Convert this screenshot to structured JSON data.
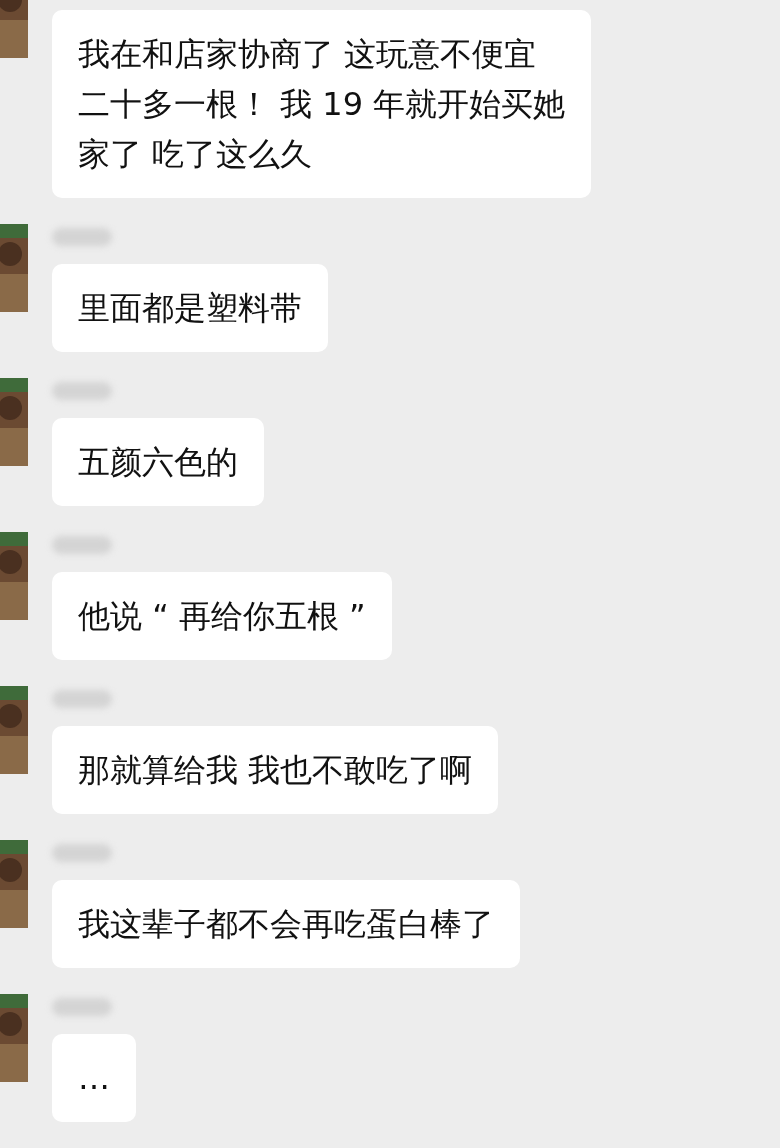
{
  "messages": [
    {
      "lines": [
        "我在和店家协商了 这玩意不便宜",
        "二十多一根！ 我 19 年就开始买她",
        "家了 吃了这么久"
      ]
    },
    {
      "lines": [
        "里面都是塑料带"
      ]
    },
    {
      "lines": [
        "五颜六色的"
      ]
    },
    {
      "lines": [
        "他说 “ 再给你五根 ”"
      ]
    },
    {
      "lines": [
        "那就算给我  我也不敢吃了啊"
      ]
    },
    {
      "lines": [
        "我这辈子都不会再吃蛋白棒了"
      ]
    },
    {
      "lines": [
        "…"
      ]
    }
  ]
}
